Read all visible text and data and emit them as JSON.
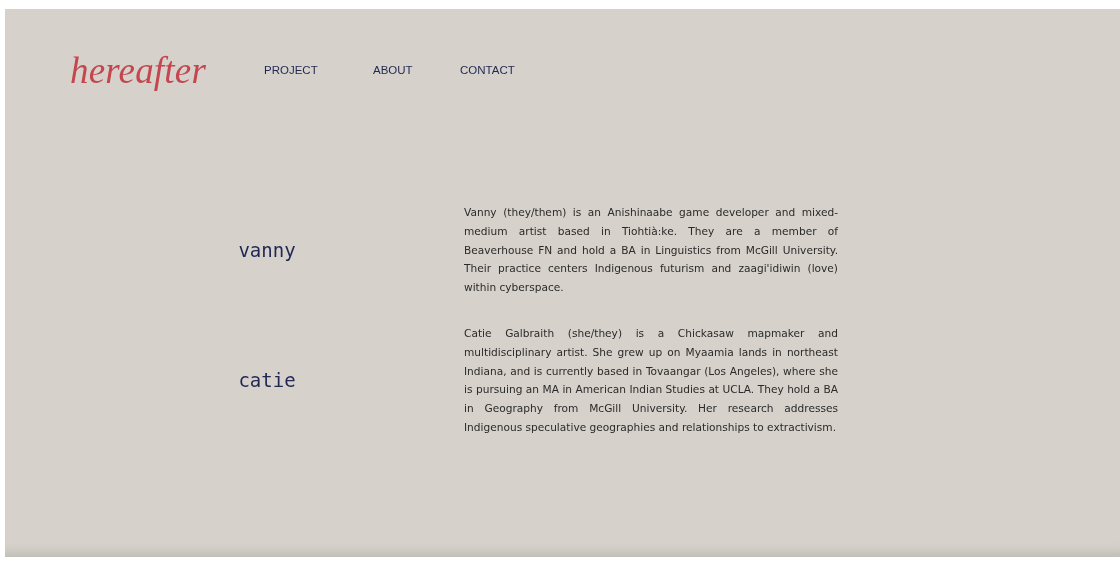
{
  "logo": "hereafter",
  "nav": [
    {
      "label": "PROJECT"
    },
    {
      "label": "ABOUT"
    },
    {
      "label": "CONTACT"
    }
  ],
  "people": [
    {
      "name": "vanny",
      "bio": "Vanny (they/them) is an Anishinaabe game developer and mixed-medium artist based in Tiohtià:ke. They are a member of Beaverhouse FN and hold a BA in Linguistics from McGill University. Their practice centers Indigenous futurism and zaagi'idiwin (love) within cyberspace."
    },
    {
      "name": "catie",
      "bio": "Catie Galbraith (she/they) is a Chickasaw mapmaker and multidisciplinary artist. She grew up on Myaamia lands in northeast Indiana, and is currently based in Tovaangar (Los Angeles), where she is pursuing an MA in American Indian Studies at UCLA. They hold a BA in Geography from McGill University. Her research addresses Indigenous speculative geographies and relationships to extractivism."
    }
  ]
}
